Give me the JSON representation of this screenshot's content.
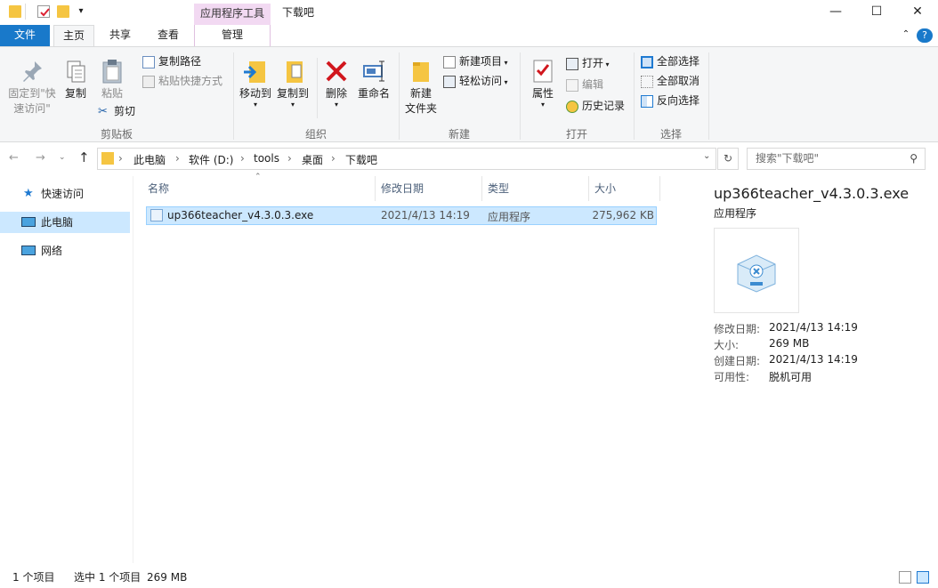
{
  "window": {
    "title": "下载吧",
    "context_tab_group": "应用程序工具",
    "minimize": "—",
    "maximize": "☐",
    "close": "✕"
  },
  "tabs": [
    {
      "label": "文件"
    },
    {
      "label": "主页"
    },
    {
      "label": "共享"
    },
    {
      "label": "查看"
    },
    {
      "label": "管理"
    }
  ],
  "ribbon": {
    "clipboard": {
      "pin": "固定到\"快",
      "pin2": "速访问\"",
      "copy": "复制",
      "paste": "粘贴",
      "copy_path": "复制路径",
      "paste_shortcut": "粘贴快捷方式",
      "cut": "剪切",
      "label": "剪贴板"
    },
    "organize": {
      "move_to": "移动到",
      "copy_to": "复制到",
      "delete": "删除",
      "rename": "重命名",
      "label": "组织"
    },
    "new": {
      "new_folder": "新建",
      "new_folder2": "文件夹",
      "new_item": "新建项目",
      "easy_access": "轻松访问",
      "label": "新建"
    },
    "open": {
      "properties": "属性",
      "open": "打开",
      "edit": "编辑",
      "history": "历史记录",
      "label": "打开"
    },
    "select": {
      "select_all": "全部选择",
      "select_none": "全部取消",
      "invert": "反向选择",
      "label": "选择"
    }
  },
  "address": {
    "crumbs": [
      "此电脑",
      "软件 (D:)",
      "tools",
      "桌面",
      "下载吧"
    ],
    "search_placeholder": "搜索\"下载吧\""
  },
  "nav": [
    {
      "label": "快速访问"
    },
    {
      "label": "此电脑"
    },
    {
      "label": "网络"
    }
  ],
  "columns": [
    "名称",
    "修改日期",
    "类型",
    "大小"
  ],
  "files": [
    {
      "name": "up366teacher_v4.3.0.3.exe",
      "date": "2021/4/13 14:19",
      "type": "应用程序",
      "size": "275,962 KB"
    }
  ],
  "details": {
    "name": "up366teacher_v4.3.0.3.exe",
    "type": "应用程序",
    "props": [
      {
        "k": "修改日期:",
        "v": "2021/4/13 14:19"
      },
      {
        "k": "大小:",
        "v": "269 MB"
      },
      {
        "k": "创建日期:",
        "v": "2021/4/13 14:19"
      },
      {
        "k": "可用性:",
        "v": "脱机可用"
      }
    ]
  },
  "status": {
    "count": "1 个项目",
    "selected": "选中 1 个项目",
    "size": "269 MB"
  },
  "colors": {
    "accent": "#1979ca",
    "selection": "#cce8ff",
    "context_tab": "#f2d9f2"
  }
}
